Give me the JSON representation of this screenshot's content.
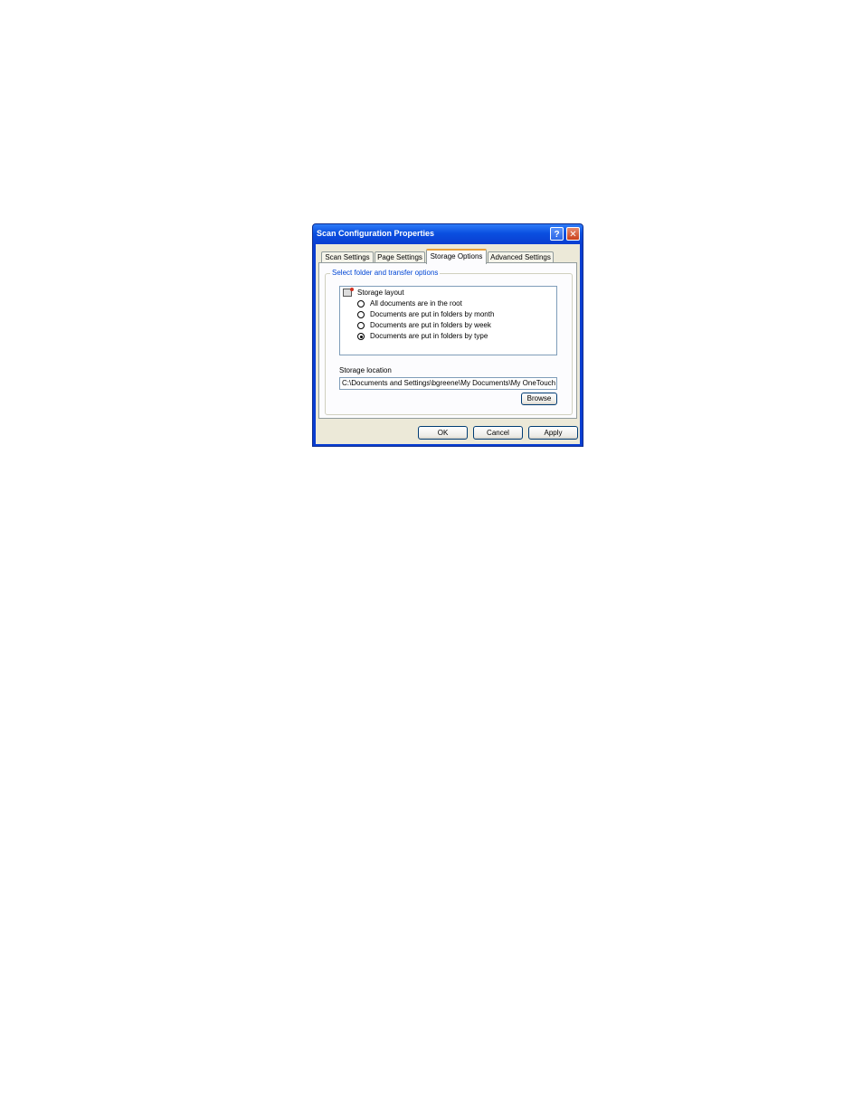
{
  "window": {
    "title": "Scan Configuration Properties",
    "help_label": "?",
    "close_label": "✕"
  },
  "tabs": [
    {
      "label": "Scan Settings",
      "active": false
    },
    {
      "label": "Page Settings",
      "active": false
    },
    {
      "label": "Storage Options",
      "active": true
    },
    {
      "label": "Advanced Settings",
      "active": false
    }
  ],
  "group": {
    "label": "Select folder and transfer options",
    "layout_label": "Storage layout",
    "layout_icon": "folder-layout-icon",
    "options": [
      {
        "label": "All documents are in the root",
        "checked": false
      },
      {
        "label": "Documents are put in folders by month",
        "checked": false
      },
      {
        "label": "Documents are put in folders by week",
        "checked": false
      },
      {
        "label": "Documents are put in folders by type",
        "checked": true
      }
    ],
    "location_label": "Storage location",
    "location_value": "C:\\Documents and Settings\\bgreene\\My Documents\\My OneTouch",
    "browse_label": "Browse"
  },
  "buttons": {
    "ok": "OK",
    "cancel": "Cancel",
    "apply": "Apply"
  },
  "colors": {
    "title_bar": "#0a3ed1",
    "active_tab_highlight": "#e8a23a",
    "group_label": "#0046d5"
  }
}
